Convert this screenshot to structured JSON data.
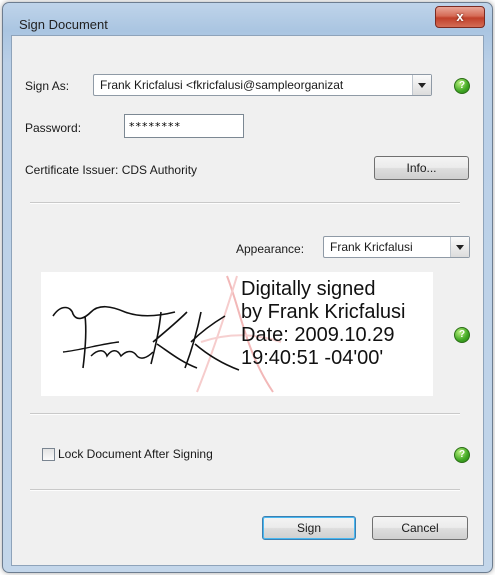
{
  "window": {
    "title": "Sign Document",
    "close_label": "x"
  },
  "sign_as": {
    "label": "Sign As:",
    "value": "Frank Kricfalusi <fkricfalusi@sampleorganizat"
  },
  "password": {
    "label": "Password:",
    "value": "********"
  },
  "certificate": {
    "issuer_text": "Certificate Issuer: CDS Authority",
    "info_button": "Info..."
  },
  "appearance": {
    "label": "Appearance:",
    "value": "Frank Kricfalusi"
  },
  "signature_preview": {
    "line1": "Digitally signed",
    "line2": "by Frank Kricfalusi",
    "line3": "Date: 2009.10.29",
    "line4": "19:40:51 -04'00'"
  },
  "lock": {
    "label": "Lock Document After Signing",
    "checked": false
  },
  "buttons": {
    "sign": "Sign",
    "cancel": "Cancel"
  },
  "help_glyph": "?",
  "colors": {
    "help_green": "#3fa623",
    "close_red": "#c0402a",
    "default_button_border": "#3c7fb1"
  }
}
